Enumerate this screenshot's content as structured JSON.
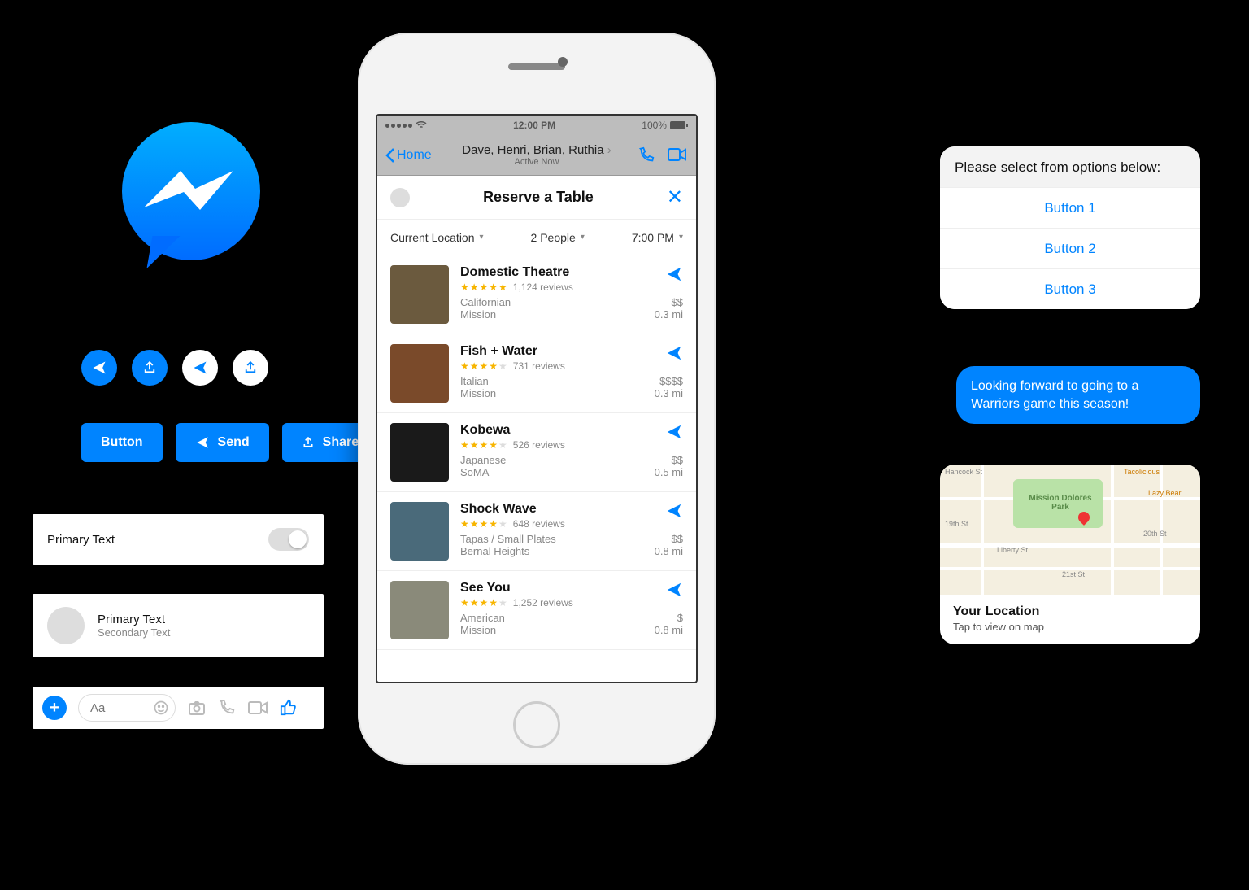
{
  "colors": {
    "accent": "#0084FF",
    "star": "#f7b500"
  },
  "left": {
    "btn_label": "Button",
    "send_label": "Send",
    "share_label": "Share",
    "primary_text": "Primary Text",
    "secondary_text": "Secondary Text",
    "compose_placeholder": "Aa"
  },
  "phone": {
    "status_time": "12:00 PM",
    "status_battery": "100%",
    "back_label": "Home",
    "chat_title": "Dave, Henri, Brian, Ruthia",
    "chat_subtitle": "Active Now",
    "sheet_title": "Reserve a Table",
    "filters": {
      "location": "Current Location",
      "people": "2 People",
      "time": "7:00 PM"
    },
    "results": [
      {
        "name": "Domestic Theatre",
        "stars": 5,
        "reviews": "1,124 reviews",
        "cuisine": "Californian",
        "area": "Mission",
        "price": "$$",
        "distance": "0.3 mi"
      },
      {
        "name": "Fish + Water",
        "stars": 4,
        "reviews": "731 reviews",
        "cuisine": "Italian",
        "area": "Mission",
        "price": "$$$$",
        "distance": "0.3 mi"
      },
      {
        "name": "Kobewa",
        "stars": 4,
        "reviews": "526 reviews",
        "cuisine": "Japanese",
        "area": "SoMA",
        "price": "$$",
        "distance": "0.5 mi"
      },
      {
        "name": "Shock Wave",
        "stars": 4,
        "reviews": "648 reviews",
        "cuisine": "Tapas / Small Plates",
        "area": "Bernal Heights",
        "price": "$$",
        "distance": "0.8 mi"
      },
      {
        "name": "See You",
        "stars": 4,
        "reviews": "1,252 reviews",
        "cuisine": "American",
        "area": "Mission",
        "price": "$",
        "distance": "0.8 mi"
      }
    ]
  },
  "right": {
    "prompt": "Please select from options below:",
    "buttons": [
      "Button 1",
      "Button 2",
      "Button 3"
    ],
    "bubble": "Looking forward to going to a Warriors game this season!",
    "map": {
      "title": "Your Location",
      "subtitle": "Tap to view on map",
      "labels": [
        "Hancock St",
        "Mission Dolores Park",
        "19th St",
        "Liberty St",
        "20th St",
        "21st St",
        "Tacolicious",
        "Lazy Bear"
      ]
    }
  }
}
